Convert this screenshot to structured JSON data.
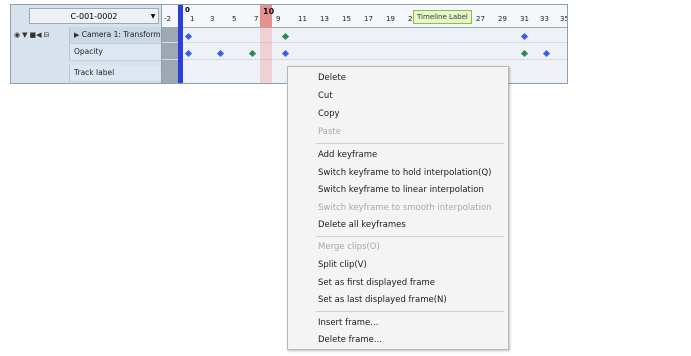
{
  "timeline": {
    "clip_selector": {
      "value": "C-001-0002"
    },
    "tracks": [
      {
        "label": "Camera 1: Transform"
      },
      {
        "label": "Opacity"
      },
      {
        "label": "Track label"
      }
    ],
    "ruler_ticks": [
      "-2",
      "1",
      "3",
      "5",
      "7",
      "9",
      "11",
      "13",
      "15",
      "17",
      "19",
      "21",
      "27",
      "29",
      "31",
      "33",
      "35"
    ],
    "current_frame": "10",
    "range_start_frame": "0",
    "tooltip": "Timeline Label"
  },
  "context_menu": {
    "items": [
      {
        "label": "Delete",
        "enabled": true
      },
      {
        "label": "Cut",
        "enabled": true
      },
      {
        "label": "Copy",
        "enabled": true
      },
      {
        "label": "Paste",
        "enabled": false
      },
      {
        "label": "Add keyframe",
        "enabled": true
      },
      {
        "label": "Switch keyframe to hold interpolation(Q)",
        "enabled": true
      },
      {
        "label": "Switch keyframe to linear interpolation",
        "enabled": true
      },
      {
        "label": "Switch keyframe to smooth interpolation",
        "enabled": false
      },
      {
        "label": "Delete all keyframes",
        "enabled": true
      },
      {
        "label": "Merge clips(O)",
        "enabled": false
      },
      {
        "label": "Split clip(V)",
        "enabled": true
      },
      {
        "label": "Set as first displayed frame",
        "enabled": true
      },
      {
        "label": "Set as last displayed frame(N)",
        "enabled": true
      },
      {
        "label": "Insert frame...",
        "enabled": true
      },
      {
        "label": "Delete frame...",
        "enabled": true
      }
    ]
  },
  "colors": {
    "keyframe_blue": "#3a5cf0",
    "keyframe_green": "#2e8a4a",
    "playhead": "#e79090",
    "range_marker": "#2d3fd9"
  },
  "icons": [
    "eye-icon",
    "expand-arrow-icon",
    "camera-icon",
    "collapse-box-icon",
    "play-triangle-icon",
    "dropdown-arrow-icon"
  ]
}
